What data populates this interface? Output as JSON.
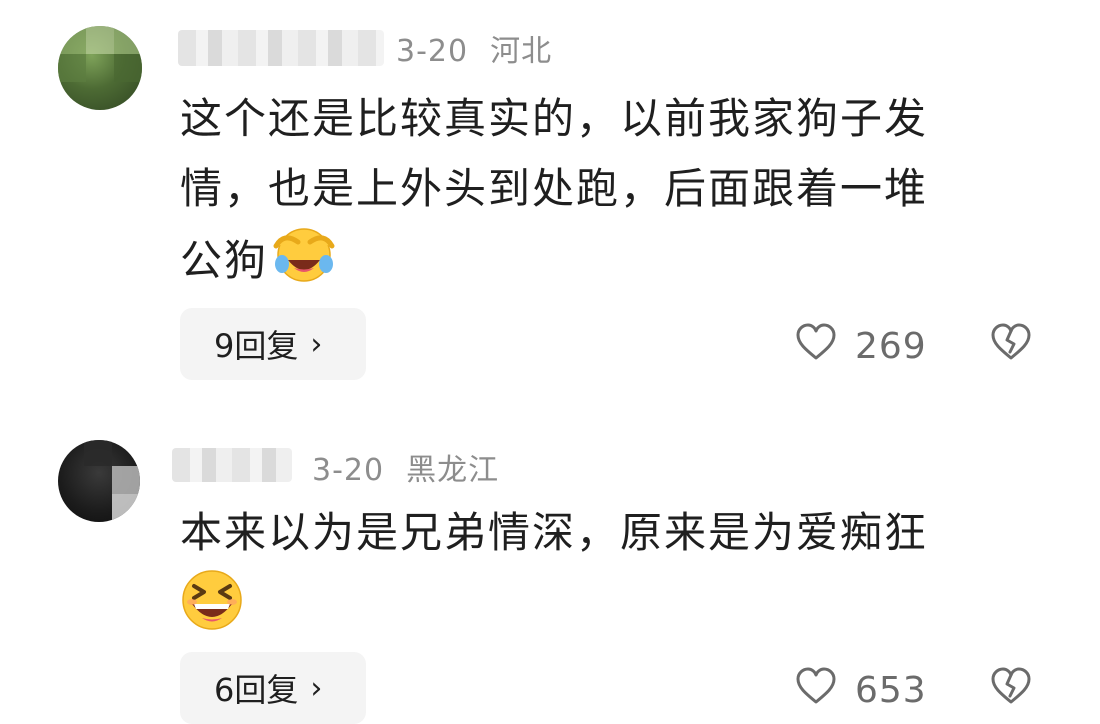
{
  "comments": [
    {
      "date": "3-20",
      "location": "河北",
      "text_lines": [
        "这个还是比较真实的，以前我家狗子发",
        "情，也是上外头到处跑，后面跟着一堆",
        "公狗"
      ],
      "emoji": "laughing-cry-emoji",
      "reply_label": "9回复",
      "reply_chevron": "›",
      "likes": "269"
    },
    {
      "date": "3-20",
      "location": "黑龙江",
      "text_lines": [
        "本来以为是兄弟情深，原来是为爱痴狂"
      ],
      "emoji": "grinning-squint-emoji",
      "reply_label": "6回复",
      "reply_chevron": "›",
      "likes": "653"
    }
  ],
  "colors": {
    "text": "#1f1f1f",
    "meta": "#8d8d8d",
    "reply_bg": "#f4f4f4",
    "icon": "#6b6b6b"
  },
  "icons": {
    "like": "heart-outline-icon",
    "dislike": "broken-heart-outline-icon"
  }
}
